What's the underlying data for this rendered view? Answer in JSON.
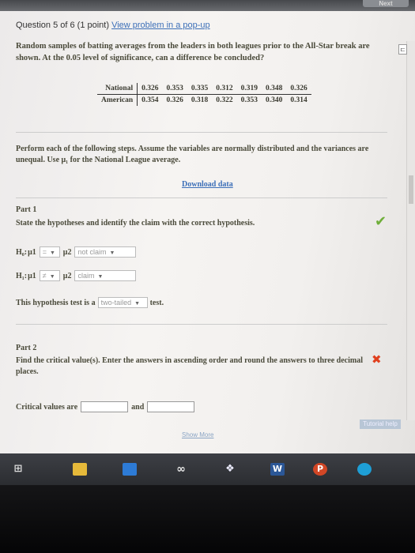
{
  "topbar": {
    "next_label": "Next"
  },
  "question": {
    "header_prefix": "Question 5 of 6 (1 point)",
    "popup_link": "View problem in a pop-up",
    "text": "Random samples of batting averages from the leaders in both leagues prior to the All-Star break are shown. At the 0.05 level of significance, can a difference be concluded?"
  },
  "table": {
    "rows": [
      {
        "label": "National",
        "values": [
          "0.326",
          "0.353",
          "0.335",
          "0.312",
          "0.319",
          "0.348",
          "0.326"
        ]
      },
      {
        "label": "American",
        "values": [
          "0.354",
          "0.326",
          "0.318",
          "0.322",
          "0.353",
          "0.340",
          "0.314"
        ]
      }
    ]
  },
  "instructions": "Perform each of the following steps. Assume the variables are normally distributed and the variances are unequal. Use μ₁ for the National League average.",
  "download_link": "Download data",
  "part1": {
    "title": "Part 1",
    "text": "State the hypotheses and identify the claim with the correct hypothesis.",
    "h0": {
      "label": "H₀:",
      "mu1": "μ1",
      "op": "=",
      "mu2": "μ2",
      "claim": "not claim"
    },
    "h1": {
      "label": "H₁:",
      "mu1": "μ1",
      "op": "≠",
      "mu2": "μ2",
      "claim": "claim"
    },
    "test_prefix": "This hypothesis test is a",
    "test_value": "two-tailed",
    "test_suffix": "test."
  },
  "part2": {
    "title": "Part 2",
    "text": "Find the critical value(s). Enter the answers in ascending order and round the answers to three decimal places.",
    "critical_label": "Critical values are",
    "and_label": "and"
  },
  "tutorial_label": "Tutorial help",
  "show_more": "Show More",
  "taskbar": {
    "icons": [
      "task-view-icon",
      "file-explorer-icon",
      "windows-store-icon",
      "infinity-app-icon",
      "dropbox-icon",
      "word-icon",
      "powerpoint-icon",
      "app-circle-icon"
    ],
    "word_letter": "W",
    "ppt_letter": "P"
  },
  "colors": {
    "link": "#3c6fb8",
    "check": "#6fae3a",
    "error": "#e0401e"
  }
}
